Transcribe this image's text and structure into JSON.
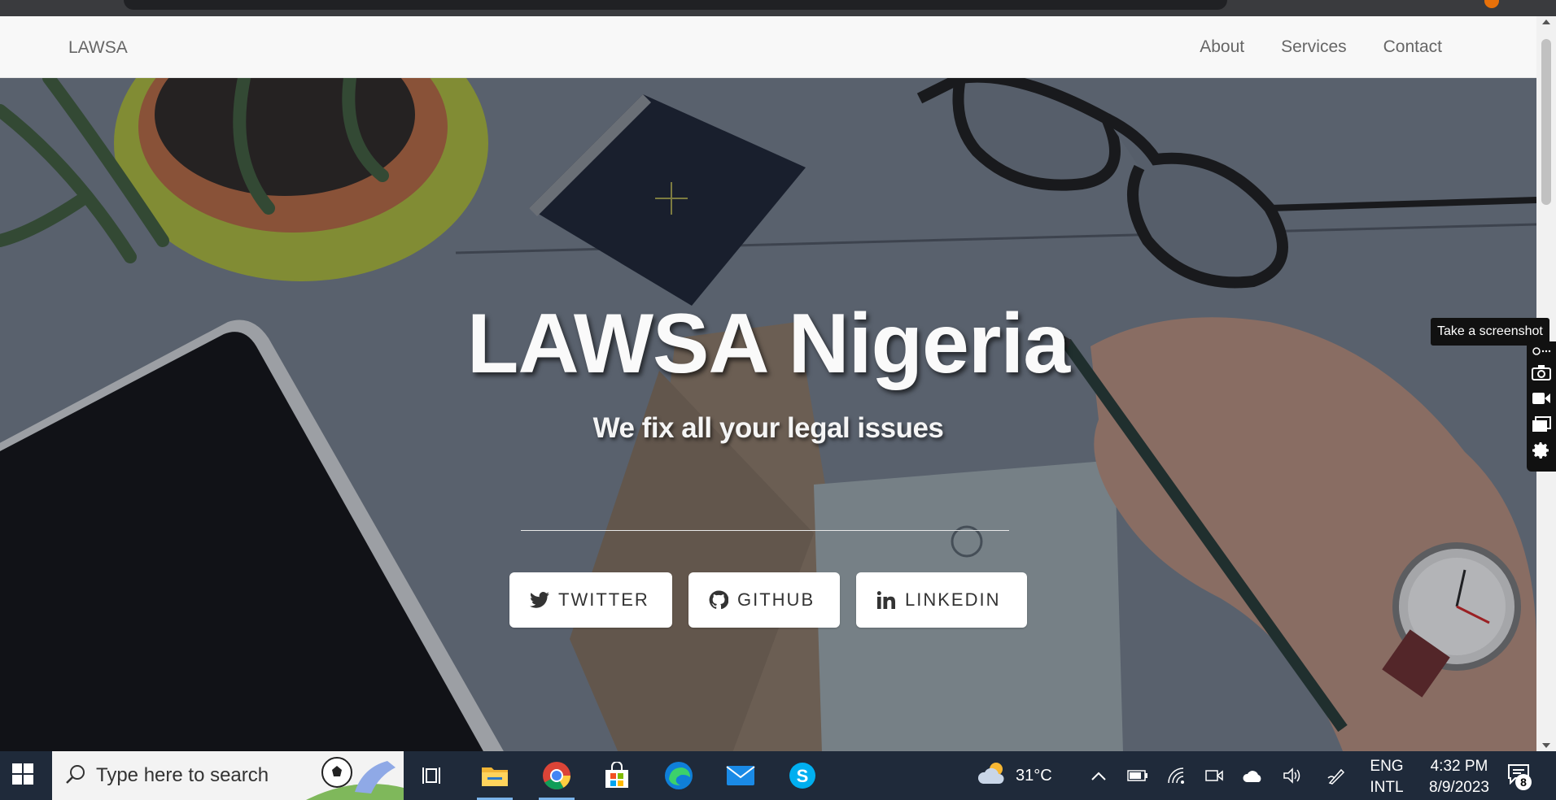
{
  "navbar": {
    "brand": "LAWSA",
    "links": [
      "About",
      "Services",
      "Contact"
    ]
  },
  "hero": {
    "title": "LAWSA Nigeria",
    "subtitle": "We fix all your legal issues",
    "buttons": [
      {
        "label": "TWITTER",
        "icon": "twitter-icon"
      },
      {
        "label": "GITHUB",
        "icon": "github-icon"
      },
      {
        "label": "LINKEDIN",
        "icon": "linkedin-icon"
      }
    ]
  },
  "screenshot_tool": {
    "tooltip": "Take a screenshot",
    "tools": [
      "more-icon",
      "camera-icon",
      "video-icon",
      "window-icon",
      "settings-icon"
    ]
  },
  "taskbar": {
    "search_placeholder": "Type here to search",
    "weather": "31°C",
    "lang_line1": "ENG",
    "lang_line2": "INTL",
    "time": "4:32 PM",
    "date": "8/9/2023",
    "notification_count": "8",
    "apps": [
      "task-view-icon",
      "file-explorer-icon",
      "chrome-icon",
      "microsoft-store-icon",
      "edge-icon",
      "mail-icon",
      "skype-icon"
    ]
  },
  "colors": {
    "navbar_bg": "#f8f8f8",
    "nav_text": "#666666",
    "taskbar_bg": "#1f2a3a",
    "button_bg": "#ffffff"
  }
}
